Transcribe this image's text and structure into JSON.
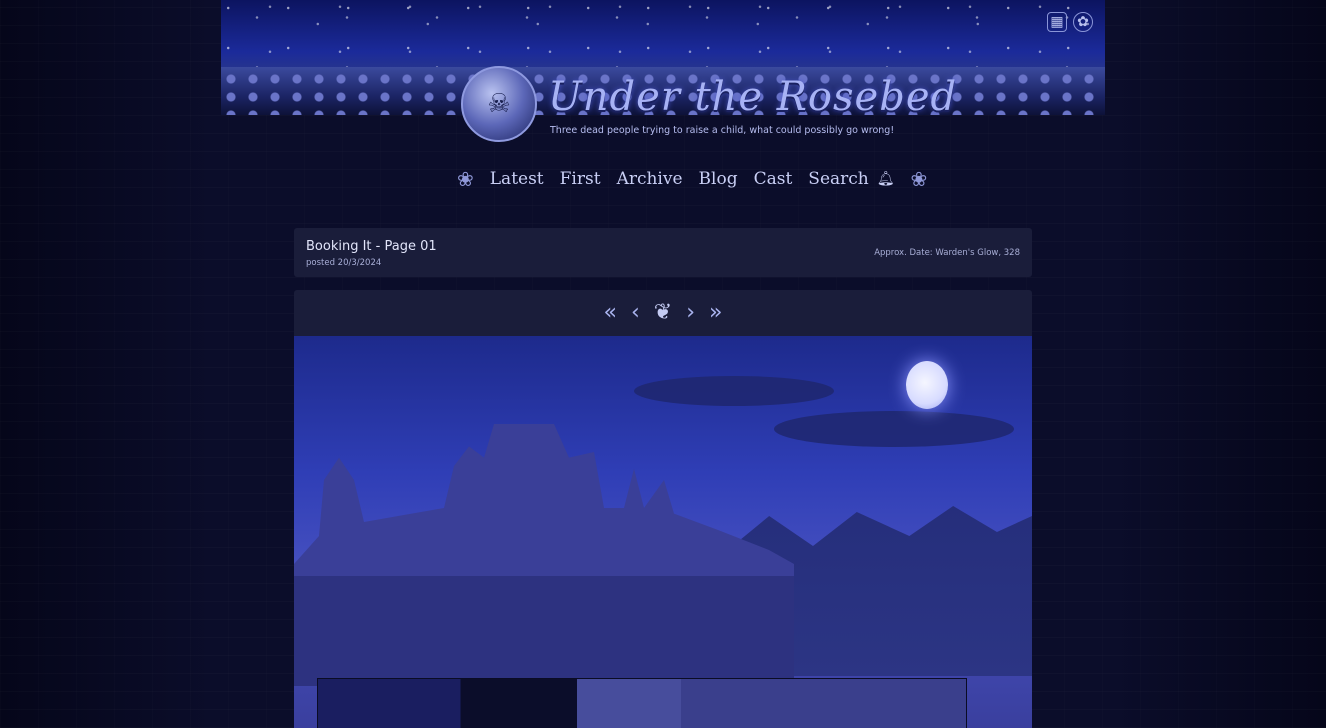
{
  "site": {
    "title": "Under the Rosebed",
    "tagline": "Three dead people trying to raise a child, what could possibly go wrong!"
  },
  "header_icons": [
    {
      "icon": "calendar-icon"
    },
    {
      "icon": "settings-icon"
    }
  ],
  "nav": {
    "items": [
      "Latest",
      "First",
      "Archive",
      "Blog",
      "Cast",
      "Search"
    ],
    "bell_icon": "bell-icon"
  },
  "post": {
    "title": "Booking It - Page 01",
    "posted": "posted 20/3/2024",
    "approx_date": "Approx. Date: Warden's Glow, 328"
  },
  "comic_nav": {
    "first": "«",
    "prev": "‹",
    "emblem": "❦",
    "next": "›",
    "last": "»"
  },
  "colors": {
    "background": "#05061a",
    "panel": "#1a1d3a",
    "accent": "#a7b2f5"
  }
}
